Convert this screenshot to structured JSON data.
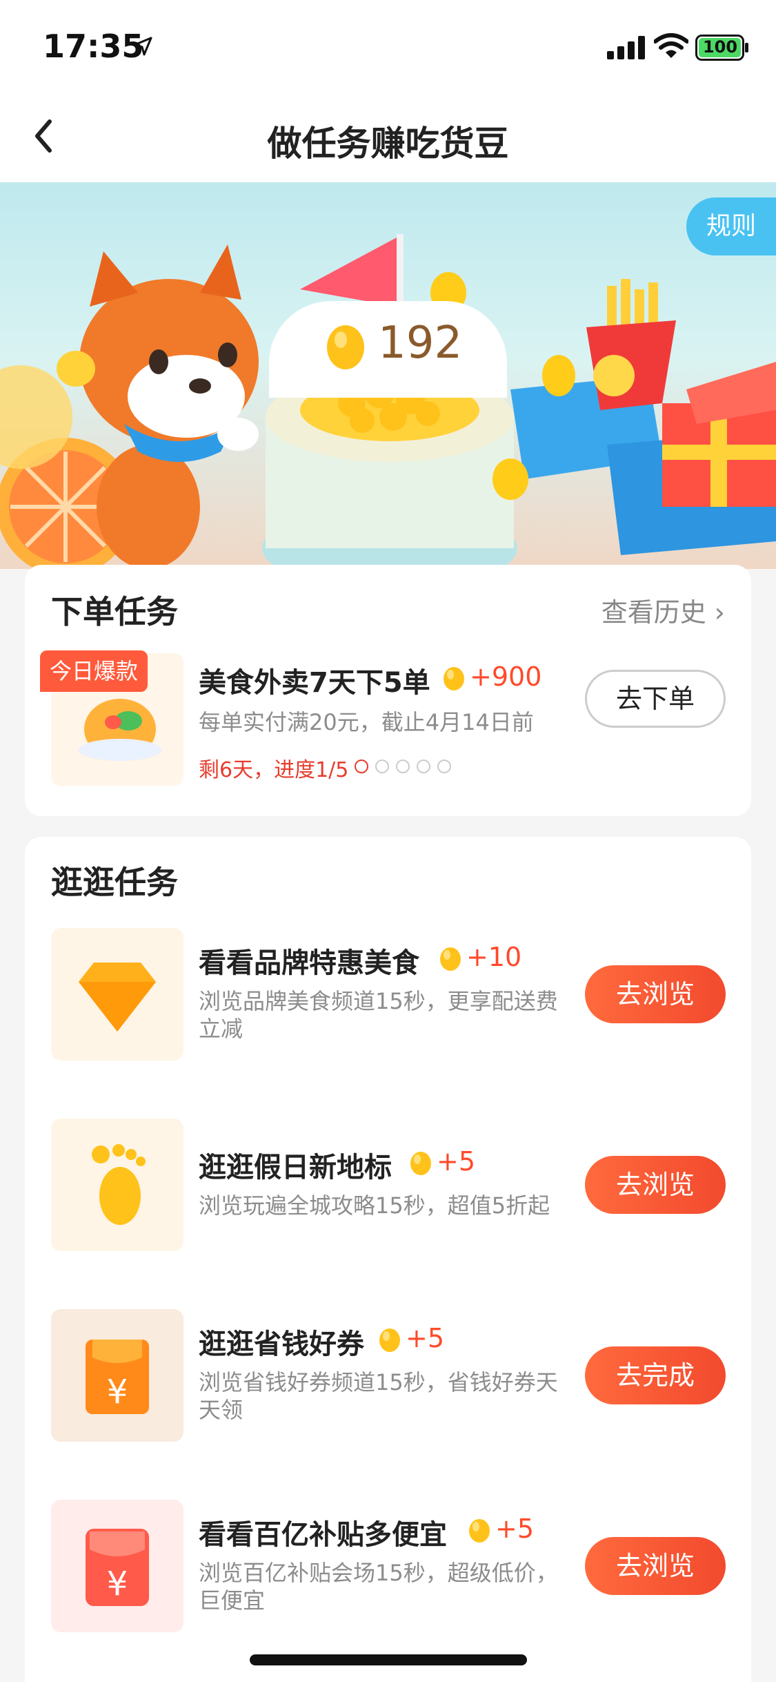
{
  "status_bar": {
    "time": "17:35",
    "battery": "100"
  },
  "nav": {
    "title": "做任务赚吃货豆"
  },
  "banner": {
    "rules_label": "规则",
    "bean_count": "192"
  },
  "order_section": {
    "title": "下单任务",
    "history_label": "查看历史 ›",
    "task": {
      "badge": "今日爆款",
      "title": "美食外卖7天下5单",
      "reward": "+900",
      "desc": "每单实付满20元，截止4月14日前",
      "progress": "剩6天，进度1/5",
      "progress_done": 1,
      "progress_total": 5,
      "button": "去下单"
    }
  },
  "browse_section": {
    "title": "逛逛任务",
    "tasks": [
      {
        "title": "看看品牌特惠美食",
        "reward": "+10",
        "desc": "浏览品牌美食频道15秒，更享配送费立减",
        "button": "去浏览",
        "icon": "diamond-icon"
      },
      {
        "title": "逛逛假日新地标",
        "reward": "+5",
        "desc": "浏览玩遍全城攻略15秒，超值5折起",
        "button": "去浏览",
        "icon": "footprint-icon"
      },
      {
        "title": "逛逛省钱好券",
        "reward": "+5",
        "desc": "浏览省钱好券频道15秒，省钱好券天天领",
        "button": "去完成",
        "icon": "coupon-icon"
      },
      {
        "title": "看看百亿补贴多便宜",
        "reward": "+5",
        "desc": "浏览百亿补贴会场15秒，超级低价，巨便宜",
        "button": "去浏览",
        "icon": "red-envelope-icon"
      }
    ]
  },
  "colors": {
    "accent": "#ff4a2a",
    "button_gradient_start": "#ff6a3d",
    "rules_blue": "#49c2f2"
  }
}
